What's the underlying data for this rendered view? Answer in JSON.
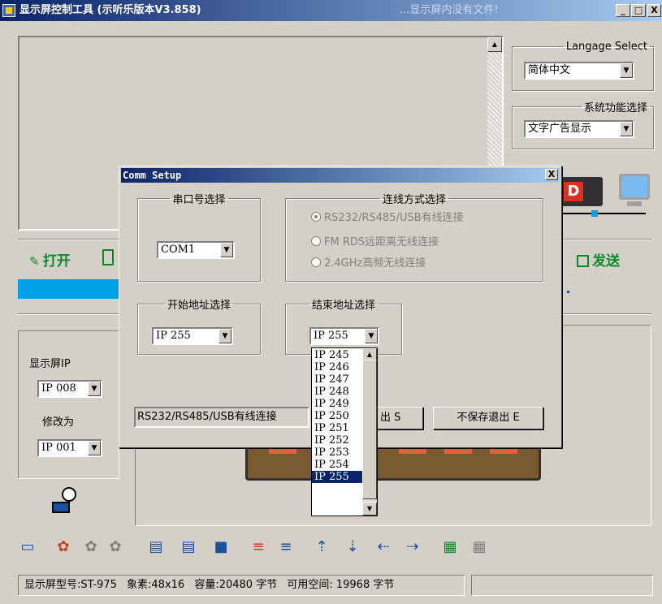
{
  "window": {
    "title": "显示屏控制工具 (示听乐版本V3.858)",
    "subtitle": "...显示屏内没有文件!",
    "min_label": "_",
    "max_label": "□",
    "close_label": "X"
  },
  "language": {
    "legend": "Langage Select",
    "value": "简体中文"
  },
  "function_select": {
    "legend": "系统功能选择",
    "value": "文字广告显示"
  },
  "main": {
    "open_label": "打开",
    "send_label": "发送"
  },
  "left_panel": {
    "display_ip_label": "显示屏IP",
    "display_ip_value": "IP 008",
    "change_to_label": "修改为",
    "change_to_value": "IP 001"
  },
  "status": {
    "model_label": "显示屏型号:ST-975",
    "pixel_label": "象素:48x16",
    "capacity_label": "容量:20480 字节",
    "free_label": "可用空间: 19968 字节"
  },
  "dialog": {
    "title": "Comm Setup",
    "close_label": "X",
    "serial_legend": "串口号选择",
    "serial_value": "COM1",
    "conn_legend": "连线方式选择",
    "conn_options": [
      "RS232/RS485/USB有线连接",
      "FM RDS远距离无线连接",
      "2.4GHz高频无线连接"
    ],
    "start_legend": "开始地址选择",
    "start_value": "IP 255",
    "end_legend": "结束地址选择",
    "end_value": "IP 255",
    "end_options": [
      "IP 245",
      "IP 246",
      "IP 247",
      "IP 248",
      "IP 249",
      "IP 250",
      "IP 251",
      "IP 252",
      "IP 253",
      "IP 254",
      "IP 255"
    ],
    "status_text": "RS232/RS485/USB有线连接",
    "save_exit_partial": "出 S",
    "nosave_exit": "不保存退出 E"
  },
  "colors": {
    "title_bar": "#0a246a",
    "progress": "#00a0e8",
    "send_green": "#0c8a2a",
    "led_red": "#e03020"
  },
  "icons": {
    "open": "folder-open-icon",
    "send": "send-icon",
    "mascot": "mascot-icon"
  }
}
